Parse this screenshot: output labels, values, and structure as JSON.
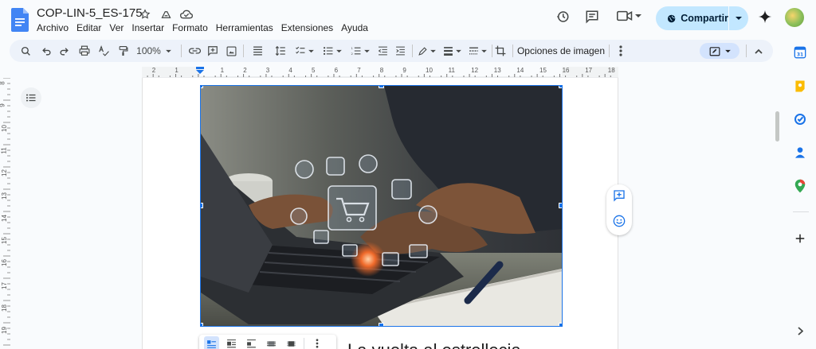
{
  "document": {
    "title": "COP-LIN-5_ES-175",
    "body_text_partial": "La vuelta al estrellecia..."
  },
  "menu": [
    "Archivo",
    "Editar",
    "Ver",
    "Insertar",
    "Formato",
    "Herramientas",
    "Extensiones",
    "Ayuda"
  ],
  "header": {
    "share_label": "Compartir"
  },
  "toolbar": {
    "zoom": "100%",
    "image_options_label": "Opciones de imagen"
  },
  "ruler": {
    "marks": [
      "2",
      "1",
      "1",
      "2",
      "3",
      "4",
      "5",
      "6",
      "7",
      "8",
      "9",
      "10",
      "11",
      "12",
      "13",
      "14",
      "15",
      "16",
      "17",
      "18"
    ]
  },
  "vruler": {
    "marks": [
      "8",
      "9",
      "10",
      "11",
      "12",
      "13",
      "14",
      "15",
      "16",
      "17",
      "18",
      "19"
    ]
  },
  "image": {
    "description_icons": [
      "megaphone-icon",
      "phone-icon",
      "globe-icon",
      "cart-icon",
      "wallet-icon",
      "target-icon",
      "location-icon",
      "mail-icon",
      "bank-icon",
      "card-icon",
      "chart-icon"
    ]
  },
  "colors": {
    "accent": "#1a73e8",
    "share_bg": "#c2e7ff",
    "toolbar_bg": "#edf2fa",
    "doc_blue": "#4285f4"
  }
}
